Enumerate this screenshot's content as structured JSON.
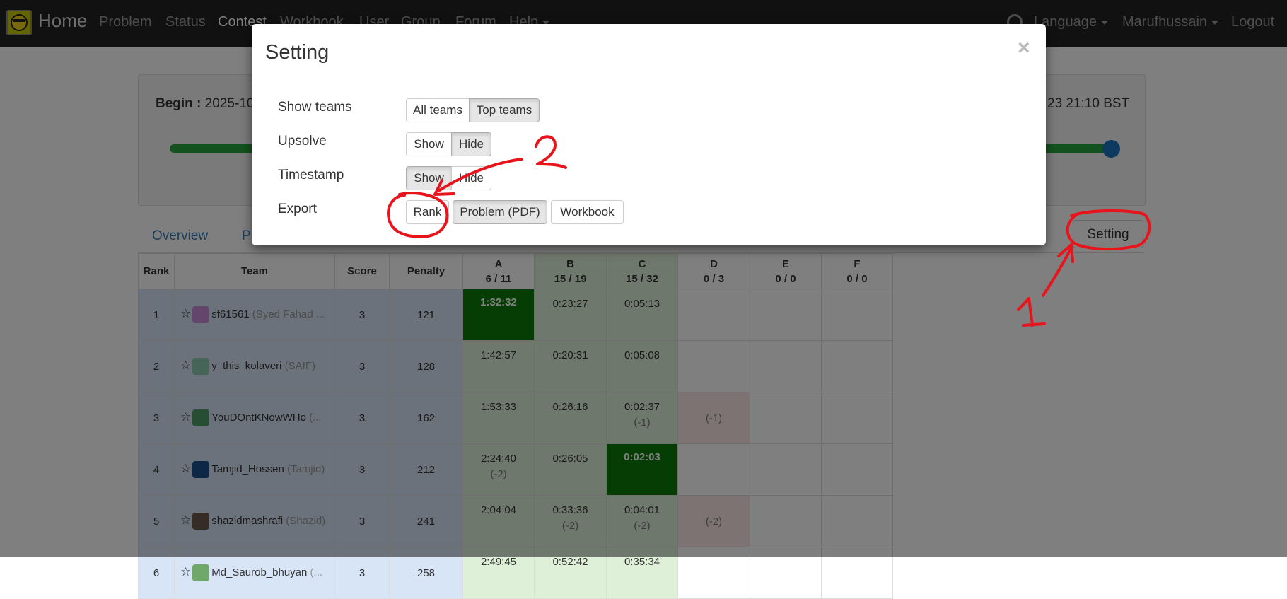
{
  "navbar": {
    "brand": "Home",
    "links": [
      "Problem",
      "Status",
      "Contest",
      "Workbook",
      "User",
      "Group",
      "Forum",
      "Help"
    ],
    "active": "Contest",
    "right": {
      "language": "Language",
      "user": "Marufhussain",
      "logout": "Logout"
    }
  },
  "contest": {
    "begin_label": "Begin :",
    "begin_value": "2025-10",
    "end_value": "23 21:10 BST",
    "progress": 1.0
  },
  "tabs": {
    "overview": "Overview",
    "p": "P"
  },
  "setting_button": "Setting",
  "table": {
    "headers": {
      "rank": "Rank",
      "team": "Team",
      "score": "Score",
      "penalty": "Penalty"
    },
    "problems": [
      {
        "letter": "A",
        "stat": "6 / 11"
      },
      {
        "letter": "B",
        "stat": "15 / 19"
      },
      {
        "letter": "C",
        "stat": "15 / 32"
      },
      {
        "letter": "D",
        "stat": "0 / 3"
      },
      {
        "letter": "E",
        "stat": "0 / 0"
      },
      {
        "letter": "F",
        "stat": "0 / 0"
      }
    ],
    "rows": [
      {
        "rank": "1",
        "user": "sf61561",
        "nick": "(Syed Fahad ...",
        "score": "3",
        "penalty": "121",
        "cells": [
          {
            "t": "1:32:32",
            "s": "fb"
          },
          {
            "t": "0:23:27",
            "s": "ac"
          },
          {
            "t": "0:05:13",
            "s": "ac"
          },
          {
            "s": "empty"
          },
          {
            "s": "empty"
          },
          {
            "s": "empty"
          }
        ]
      },
      {
        "rank": "2",
        "user": "y_this_kolaveri",
        "nick": "(SAIF)",
        "score": "3",
        "penalty": "128",
        "cells": [
          {
            "t": "1:42:57",
            "s": "ac"
          },
          {
            "t": "0:20:31",
            "s": "ac"
          },
          {
            "t": "0:05:08",
            "s": "ac"
          },
          {
            "s": "empty"
          },
          {
            "s": "empty"
          },
          {
            "s": "empty"
          }
        ]
      },
      {
        "rank": "3",
        "user": "YouDOntKNowWHo",
        "nick": "(...",
        "score": "3",
        "penalty": "162",
        "cells": [
          {
            "t": "1:53:33",
            "s": "ac"
          },
          {
            "t": "0:26:16",
            "s": "ac"
          },
          {
            "t": "0:02:37",
            "x": "(-1)",
            "s": "ac"
          },
          {
            "x": "(-1)",
            "s": "wa"
          },
          {
            "s": "empty"
          },
          {
            "s": "empty"
          }
        ]
      },
      {
        "rank": "4",
        "user": "Tamjid_Hossen",
        "nick": "(Tamjid)",
        "score": "3",
        "penalty": "212",
        "cells": [
          {
            "t": "2:24:40",
            "x": "(-2)",
            "s": "ac"
          },
          {
            "t": "0:26:05",
            "s": "ac"
          },
          {
            "t": "0:02:03",
            "s": "fb"
          },
          {
            "s": "empty"
          },
          {
            "s": "empty"
          },
          {
            "s": "empty"
          }
        ]
      },
      {
        "rank": "5",
        "user": "shazidmashrafi",
        "nick": "(Shazid)",
        "score": "3",
        "penalty": "241",
        "cells": [
          {
            "t": "2:04:04",
            "s": "ac"
          },
          {
            "t": "0:33:36",
            "x": "(-2)",
            "s": "ac"
          },
          {
            "t": "0:04:01",
            "x": "(-2)",
            "s": "ac"
          },
          {
            "x": "(-2)",
            "s": "wa"
          },
          {
            "s": "empty"
          },
          {
            "s": "empty"
          }
        ]
      },
      {
        "rank": "6",
        "user": "Md_Saurob_bhuyan",
        "nick": "(...",
        "score": "3",
        "penalty": "258",
        "cells": [
          {
            "t": "2:49:45",
            "s": "ac"
          },
          {
            "t": "0:52:42",
            "s": "ac"
          },
          {
            "t": "0:35:34",
            "s": "ac"
          },
          {
            "s": "empty"
          },
          {
            "s": "empty"
          },
          {
            "s": "empty"
          }
        ]
      }
    ]
  },
  "modal": {
    "title": "Setting",
    "close": "×",
    "rows": {
      "show_teams": {
        "label": "Show teams",
        "options": [
          "All teams",
          "Top teams"
        ],
        "selected": "Top teams"
      },
      "upsolve": {
        "label": "Upsolve",
        "options": [
          "Show",
          "Hide"
        ],
        "selected": "Hide"
      },
      "timestamp": {
        "label": "Timestamp",
        "options": [
          "Show",
          "Hide"
        ],
        "selected": "Show"
      },
      "export": {
        "label": "Export",
        "buttons": [
          "Rank",
          "Problem (PDF)",
          "Workbook"
        ]
      }
    }
  },
  "annotations": {
    "one": "1",
    "two": "2"
  },
  "colors": {
    "navbar": "#222222",
    "accepted": "#dff0d8",
    "first_blood": "#0a7a0a",
    "wrong": "#fde7e7",
    "rank_bg": "#d7e5f7",
    "progress": "#27a53d",
    "annotation": "#e8141c"
  }
}
